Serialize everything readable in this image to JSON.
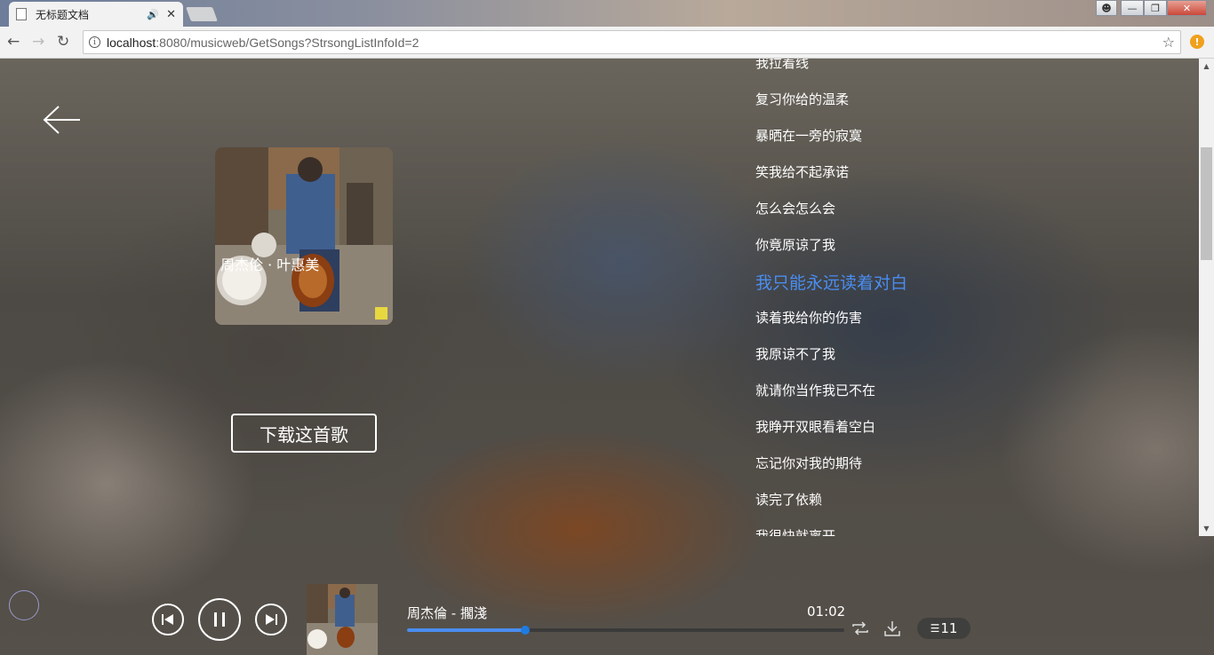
{
  "browser": {
    "tab_title": "无标题文档",
    "url_host": "localhost",
    "url_rest": ":8080/musicweb/GetSongs?StrsongListInfoId=2"
  },
  "page": {
    "download_label": "下载这首歌",
    "lyrics": [
      {
        "text": "我拉着线",
        "current": false
      },
      {
        "text": "复习你给的温柔",
        "current": false
      },
      {
        "text": "暴晒在一旁的寂寞",
        "current": false
      },
      {
        "text": "笑我给不起承诺",
        "current": false
      },
      {
        "text": "怎么会怎么会",
        "current": false
      },
      {
        "text": "你竟原谅了我",
        "current": false
      },
      {
        "text": "我只能永远读着对白",
        "current": true
      },
      {
        "text": "读着我给你的伤害",
        "current": false
      },
      {
        "text": "我原谅不了我",
        "current": false
      },
      {
        "text": "就请你当作我已不在",
        "current": false
      },
      {
        "text": "我睁开双眼看着空白",
        "current": false
      },
      {
        "text": "忘记你对我的期待",
        "current": false
      },
      {
        "text": "读完了依赖",
        "current": false
      },
      {
        "text": "我很快就离开",
        "current": false
      }
    ]
  },
  "player": {
    "song_title": "周杰倫 - 擱淺",
    "current_time": "01:02",
    "progress": 0.27,
    "playlist_count": "11",
    "accent": "#4a8df0"
  }
}
